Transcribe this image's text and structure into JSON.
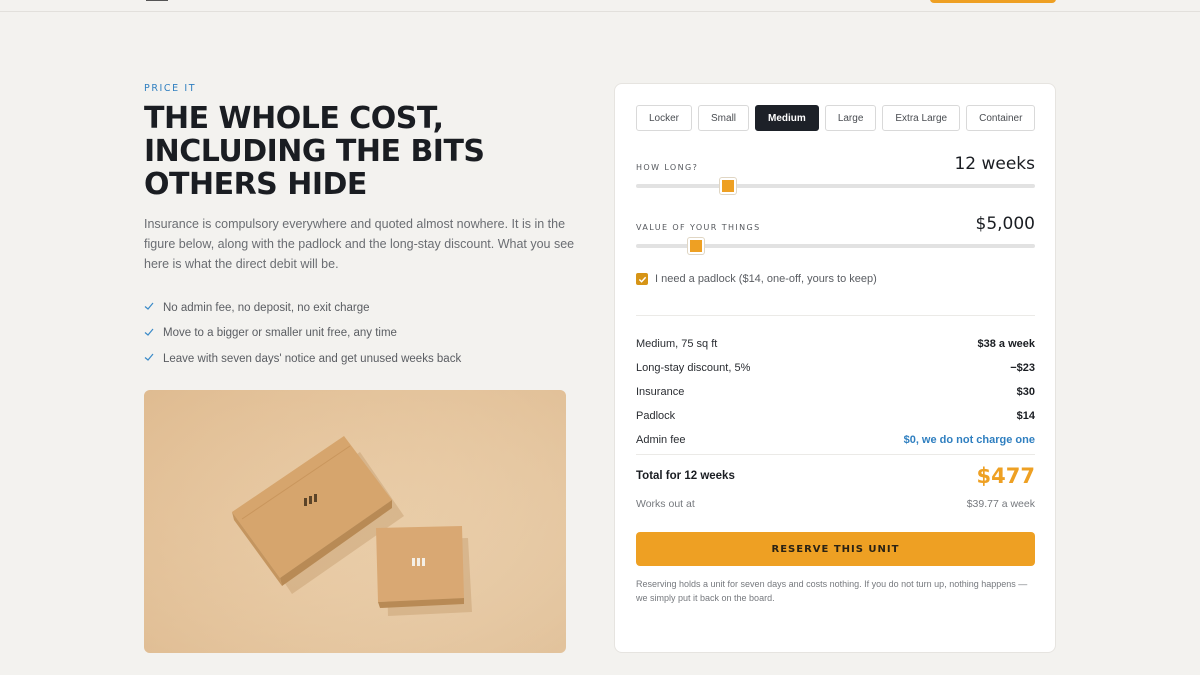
{
  "section": {
    "eyebrow": "PRICE IT",
    "headline": [
      "THE WHOLE COST,",
      "INCLUDING THE BITS",
      "OTHERS HIDE"
    ],
    "lede": "Insurance is compulsory everywhere and quoted almost nowhere. It is in the figure below, along with the padlock and the long-stay discount. What you see here is what the direct debit will be.",
    "benefits": [
      "No admin fee, no deposit, no exit charge",
      "Move to a bigger or smaller unit free, any time",
      "Leave with seven days' notice and get unused weeks back"
    ],
    "photo_icon": "cardboard-boxes-photo"
  },
  "calculator": {
    "sizes": [
      "Locker",
      "Small",
      "Medium",
      "Large",
      "Extra Large",
      "Container"
    ],
    "selected_size": "Medium",
    "duration": {
      "label": "HOW LONG?",
      "value": "12 weeks",
      "level": 0.23
    },
    "value_of_things": {
      "label": "VALUE OF YOUR THINGS",
      "value": "$5,000",
      "level": 0.15
    },
    "padlock": {
      "checked": true,
      "label": "I need a padlock ($14, one-off, yours to keep)"
    },
    "lines": [
      {
        "label": "Medium, 75 sq ft",
        "amount": "$38 a week"
      },
      {
        "label": "Long-stay discount, 5%",
        "amount": "−$23"
      },
      {
        "label": "Insurance",
        "amount": "$30"
      },
      {
        "label": "Padlock",
        "amount": "$14"
      },
      {
        "label": "Admin fee",
        "amount": "$0, we do not charge one"
      }
    ],
    "total": {
      "label": "Total for 12 weeks",
      "amount": "$477"
    },
    "works_out": {
      "label": "Works out at",
      "amount": "$39.77 a week"
    },
    "reserve_label": "RESERVE THIS UNIT",
    "footnote": "Reserving holds a unit for seven days and costs nothing. If you do not turn up, nothing happens — we simply put it back on the board."
  },
  "colors": {
    "accent": "#eea023",
    "link": "#2f7fc0",
    "dark": "#1d2128"
  }
}
